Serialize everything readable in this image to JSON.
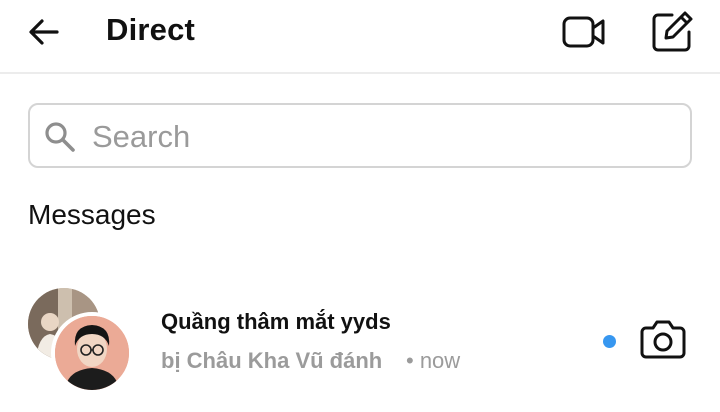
{
  "header": {
    "title": "Direct",
    "back_icon": "arrow-left-icon",
    "video_icon": "video-camera-icon",
    "compose_icon": "compose-icon"
  },
  "search": {
    "placeholder": "Search",
    "value": "",
    "icon": "search-icon"
  },
  "messages_section": {
    "title": "Messages"
  },
  "conversations": [
    {
      "name": "Quầng thâm mắt yyds",
      "preview": "bị Châu Kha Vũ đánh",
      "time": "• now",
      "unread": true,
      "camera_icon": "camera-icon"
    }
  ],
  "colors": {
    "unread_dot": "#3797f0",
    "secondary_text": "#9b9b9b",
    "divider": "#ececec"
  }
}
